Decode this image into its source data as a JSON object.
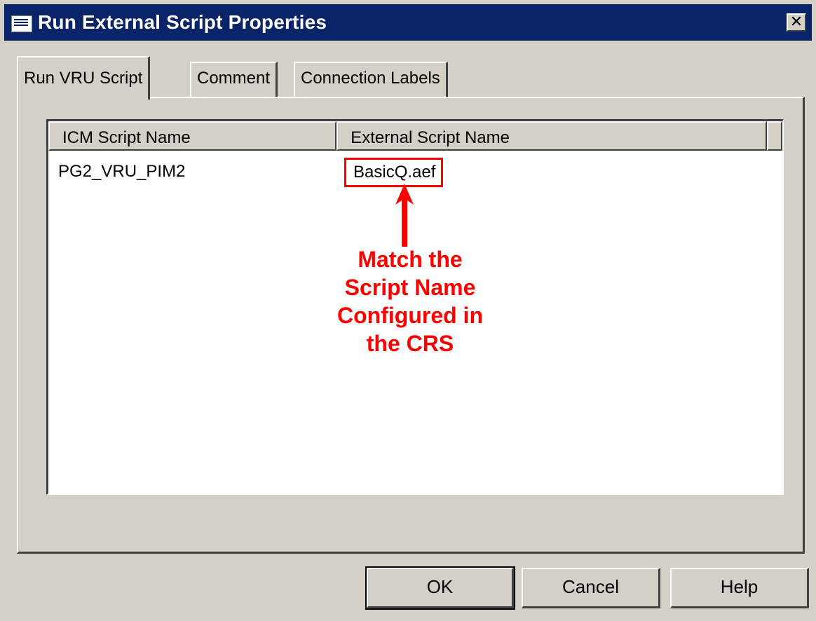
{
  "window": {
    "title": "Run External Script Properties",
    "close_glyph": "✕"
  },
  "tabs": [
    {
      "label": "Run VRU Script",
      "active": true
    },
    {
      "label": "Comment",
      "active": false
    },
    {
      "label": "Connection Labels",
      "active": false
    }
  ],
  "list": {
    "columns": [
      "ICM Script Name",
      "External Script Name"
    ],
    "rows": [
      {
        "icm_script_name": "PG2_VRU_PIM2",
        "external_script_name": "BasicQ.aef"
      }
    ]
  },
  "annotation": {
    "lines": [
      "Match the",
      "Script Name",
      "Configured in",
      "the CRS"
    ],
    "color": "#ff0000"
  },
  "buttons": {
    "ok": "OK",
    "cancel": "Cancel",
    "help": "Help"
  },
  "icons": {
    "title_icon": "script-properties-icon",
    "close_icon": "close-icon",
    "arrow": "up-arrow-icon"
  },
  "colors": {
    "titlebar": "#0a246a",
    "face": "#d4d0c8",
    "highlight": "#ff0000"
  }
}
